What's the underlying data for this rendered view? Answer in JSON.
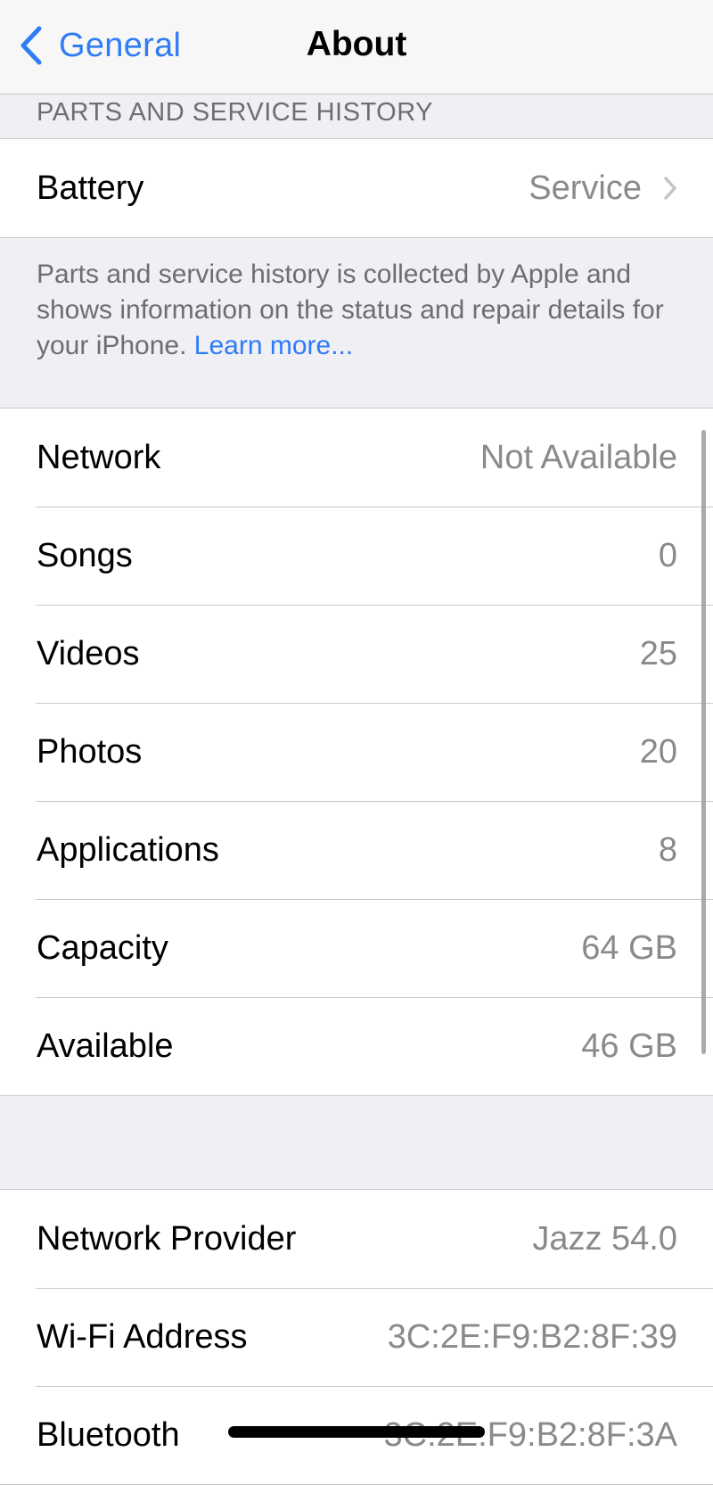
{
  "nav": {
    "back_label": "General",
    "title": "About"
  },
  "parts_section": {
    "header": "PARTS AND SERVICE HISTORY",
    "battery_label": "Battery",
    "battery_value": "Service",
    "note_text": "Parts and service history is collected by Apple and shows information on the status and repair details for your iPhone. ",
    "note_link": "Learn more..."
  },
  "stats": [
    {
      "label": "Network",
      "value": "Not Available"
    },
    {
      "label": "Songs",
      "value": "0"
    },
    {
      "label": "Videos",
      "value": "25"
    },
    {
      "label": "Photos",
      "value": "20"
    },
    {
      "label": "Applications",
      "value": "8"
    },
    {
      "label": "Capacity",
      "value": "64 GB"
    },
    {
      "label": "Available",
      "value": "46 GB"
    }
  ],
  "network_info": [
    {
      "label": "Network Provider",
      "value": "Jazz 54.0"
    },
    {
      "label": "Wi-Fi Address",
      "value": "3C:2E:F9:B2:8F:39"
    },
    {
      "label": "Bluetooth",
      "value": "3C:2E:F9:B2:8F:3A"
    }
  ],
  "colors": {
    "accent": "#2f7cf6",
    "background": "#efeff4",
    "secondary_text": "#8a8a8e"
  }
}
